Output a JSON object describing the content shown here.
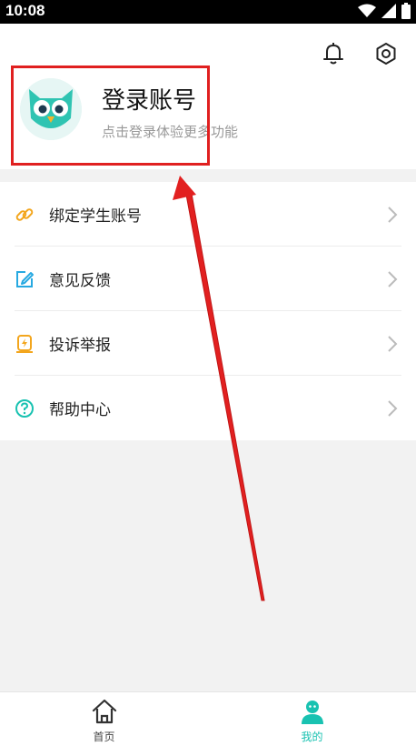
{
  "status_bar": {
    "time": "10:08"
  },
  "profile": {
    "title": "登录账号",
    "subtitle": "点击登录体验更多功能"
  },
  "menu": {
    "items": [
      {
        "label": "绑定学生账号",
        "icon": "link-icon",
        "color": "#f3a61d"
      },
      {
        "label": "意见反馈",
        "icon": "edit-icon",
        "color": "#27a9e1"
      },
      {
        "label": "投诉举报",
        "icon": "report-icon",
        "color": "#f3a61d"
      },
      {
        "label": "帮助中心",
        "icon": "help-icon",
        "color": "#19c2b1"
      }
    ]
  },
  "tabs": [
    {
      "label": "首页",
      "icon": "home-icon",
      "active": false
    },
    {
      "label": "我的",
      "icon": "user-icon",
      "active": true
    }
  ],
  "colors": {
    "accent": "#19c2b1",
    "highlight": "#e02020"
  }
}
